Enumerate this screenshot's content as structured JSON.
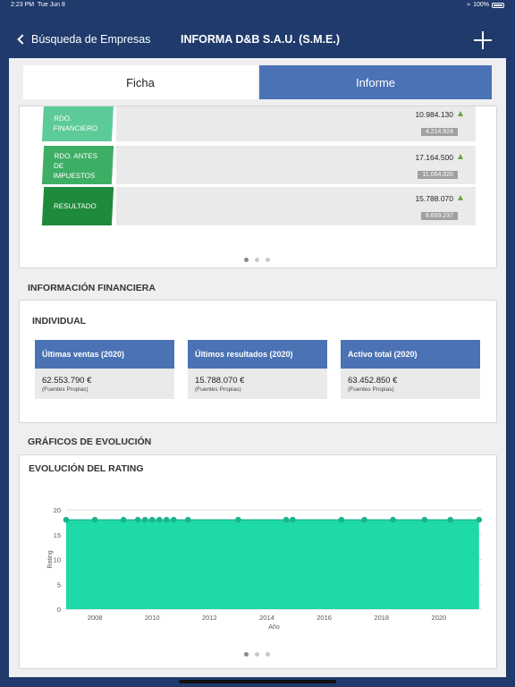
{
  "status": {
    "time": "2:23 PM",
    "date": "Tue Jun 8",
    "battery": "100%"
  },
  "nav": {
    "back_label": "Búsqueda de Empresas",
    "title": "INFORMA D&B S.A.U. (S.M.E.)"
  },
  "tabs": [
    {
      "label": "Ficha"
    },
    {
      "label": "Informe"
    }
  ],
  "results": [
    {
      "label_lines": [
        "RDO.",
        "FINANCIERO"
      ],
      "value": "10.984.130",
      "previous": "4.214.924",
      "color": "#5ccb98"
    },
    {
      "label_lines": [
        "RDO. ANTES",
        "DE",
        "IMPUESTOS"
      ],
      "value": "17.164.500",
      "previous": "11.064.020",
      "color": "#3fae65"
    },
    {
      "label_lines": [
        "RESULTADO"
      ],
      "value": "15.788.070",
      "previous": "9.669.237",
      "color": "#1f8a3b"
    }
  ],
  "financial": {
    "section_title": "INFORMACIÓN FINANCIERA",
    "card_title": "INDIVIDUAL",
    "boxes": [
      {
        "title": "Últimas ventas (2020)",
        "amount": "62.553.790 €",
        "source": "(Fuentes Propias)"
      },
      {
        "title": "Últimos resultados (2020)",
        "amount": "15.788.070 €",
        "source": "(Fuentes Propias)"
      },
      {
        "title": "Activo total (2020)",
        "amount": "63.452.850 €",
        "source": "(Fuentes Propias)"
      }
    ]
  },
  "evolution": {
    "section_title": "GRÁFICOS DE EVOLUCIÓN"
  },
  "colors": {
    "accent": "#4a72b4",
    "navbar": "#1f3a6b",
    "chart_fill": "#1ed9a8",
    "chart_point": "#19b58c"
  },
  "chart_data": {
    "type": "area",
    "title": "EVOLUCIÓN DEL RATING",
    "xlabel": "Año",
    "ylabel": "Rating",
    "xlim": [
      2007,
      2021.5
    ],
    "ylim": [
      0,
      20
    ],
    "xticks": [
      2008,
      2010,
      2012,
      2014,
      2016,
      2018,
      2020
    ],
    "yticks": [
      0,
      5,
      10,
      15,
      20
    ],
    "grid": true,
    "x": [
      2007.0,
      2008.0,
      2009.0,
      2009.5,
      2009.75,
      2010.0,
      2010.25,
      2010.5,
      2010.75,
      2011.25,
      2013.0,
      2014.67,
      2014.9,
      2016.6,
      2017.4,
      2018.4,
      2019.5,
      2020.4,
      2021.4
    ],
    "y": [
      18,
      18,
      18,
      18,
      18,
      18,
      18,
      18,
      18,
      18,
      18,
      18,
      18,
      18,
      18,
      18,
      18,
      18,
      18
    ]
  }
}
